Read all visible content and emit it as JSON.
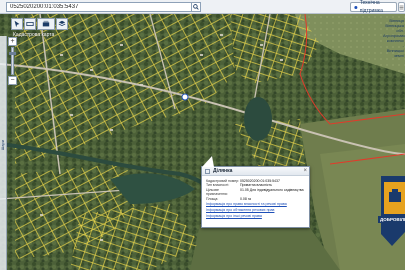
{
  "search": {
    "value": "0525020200:01:035:5437"
  },
  "topbar": {
    "layers_label": "Технічна підтримка"
  },
  "breadcrumb": {
    "text": "Кадастрова карта"
  },
  "legend": {
    "lines": [
      "Вінниця",
      "Вінницька обл.",
      "Агропромисловий",
      "комплекс",
      "-",
      "Вінницькі",
      "землі"
    ]
  },
  "rail": {
    "label": "Шари"
  },
  "popup": {
    "title": "Ділянка",
    "rows": [
      {
        "label": "Кадастровий номер:",
        "value": "0525020200:01:035:5437"
      },
      {
        "label": "Тип власності:",
        "value": "Приватна власність"
      },
      {
        "label": "Цільове призначення:",
        "value": "01.05 Для індивідуального садівництва"
      },
      {
        "label": "Площа:",
        "value": "0.08 га"
      }
    ],
    "links": [
      "Інформація про право власності та речові права",
      "Інформація про обтяження речових прав",
      "Інформація про інші речові права"
    ]
  },
  "badge": {
    "label": "ДОБРОВІЛЬНА"
  },
  "colors": {
    "parcel_line": "#e8d44a",
    "boundary": "#e23a2a",
    "water": "#2c4b3e",
    "road": "#c9c2b3"
  }
}
